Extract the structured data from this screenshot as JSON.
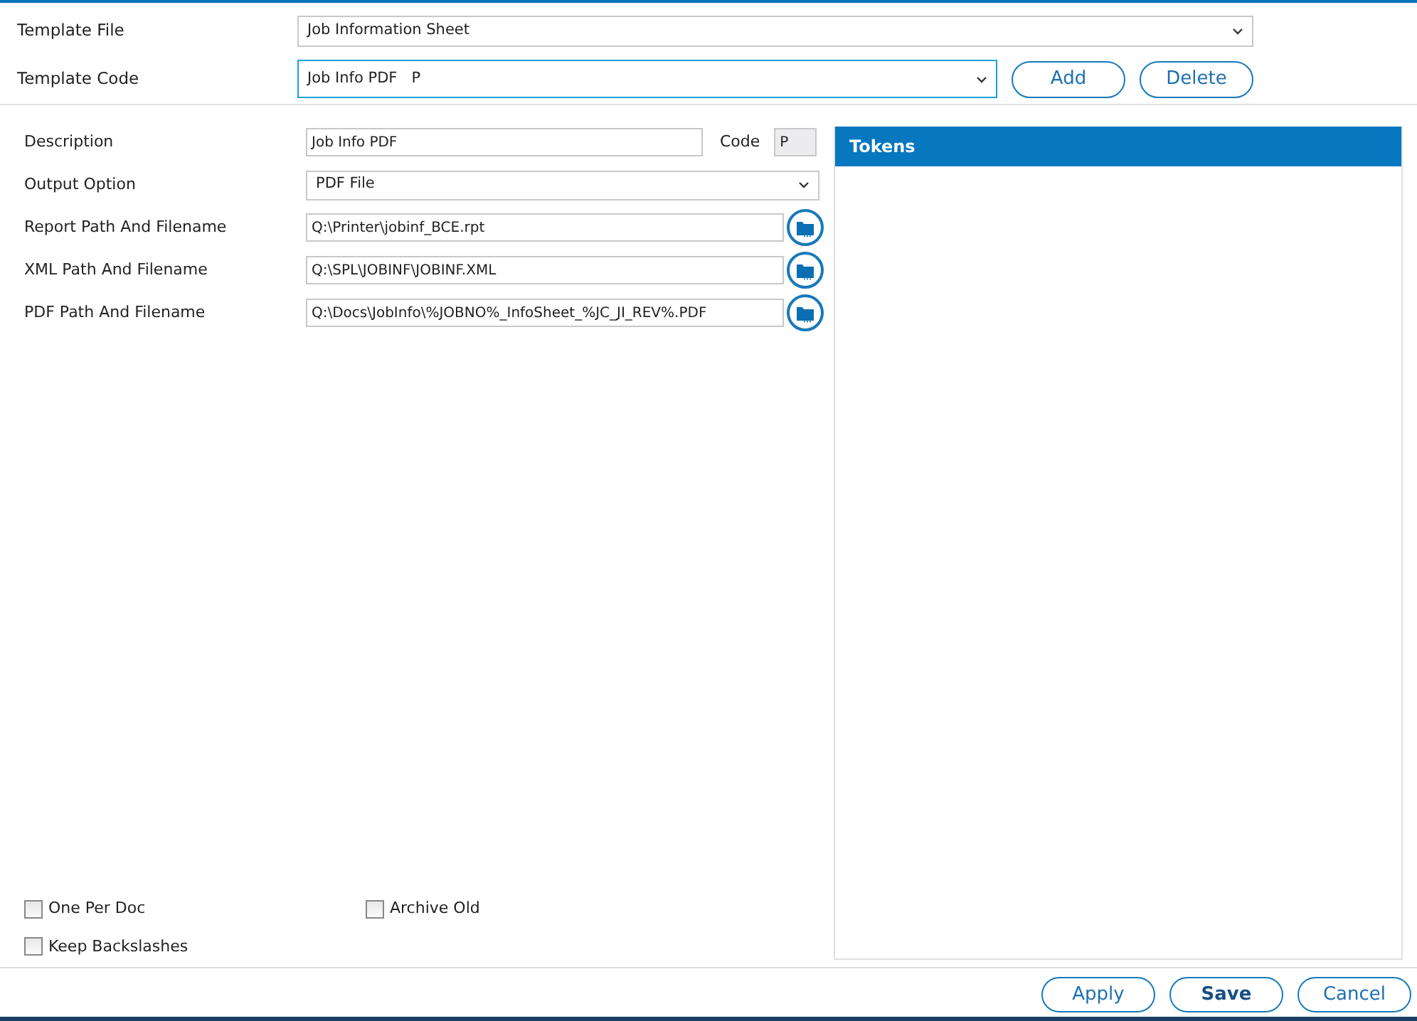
{
  "template_file": {
    "label": "Template File",
    "value": "Job Information Sheet",
    "focused": false
  },
  "template_code": {
    "label": "Template Code",
    "value": "Job Info PDF   P",
    "focused": true
  },
  "code_buttons": [
    {
      "label": "Add"
    },
    {
      "label": "Delete"
    }
  ],
  "description": {
    "label": "Description",
    "value": "Job Info PDF",
    "code_label": "Code",
    "code_value": "P"
  },
  "output_option": {
    "label": "Output Option",
    "value": "PDF File"
  },
  "paths": [
    {
      "label": "Report Path And Filename",
      "value": "Q:\\Printer\\jobinf_BCE.rpt"
    },
    {
      "label": "XML Path And Filename",
      "value": "Q:\\SPL\\JOBINF\\JOBINF.XML"
    },
    {
      "label": "PDF Path And Filename",
      "value": "Q:\\Docs\\JobInfo\\%JOBNO%_InfoSheet_%JC_JI_REV%.PDF"
    }
  ],
  "tokens": {
    "title": "Tokens"
  },
  "checkboxes": [
    {
      "label": "One Per Doc",
      "checked": false
    },
    {
      "label": "Archive Old",
      "checked": false
    },
    {
      "label": "Keep Backslashes",
      "checked": false
    }
  ],
  "buttons": [
    {
      "label": "Apply",
      "default": false
    },
    {
      "label": "Save",
      "default": true
    },
    {
      "label": "Cancel",
      "default": false
    }
  ]
}
